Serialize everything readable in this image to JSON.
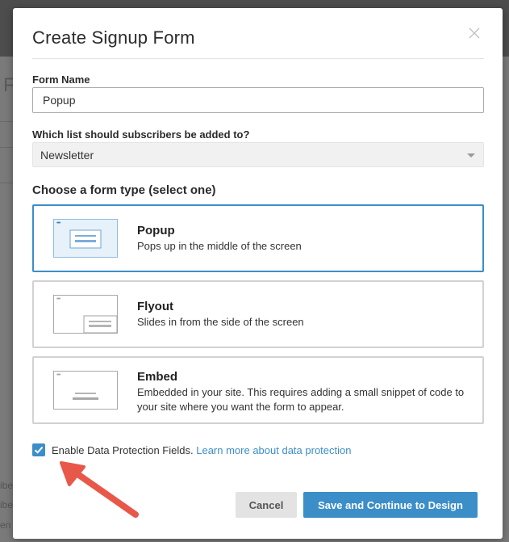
{
  "background": {
    "edge_letter": "F",
    "edge_fragments": [
      "ibe",
      "ibe",
      "en"
    ]
  },
  "modal": {
    "title": "Create Signup Form",
    "close_icon": "close-icon"
  },
  "form_name": {
    "label": "Form Name",
    "value": "Popup"
  },
  "list_select": {
    "label": "Which list should subscribers be added to?",
    "selected": "Newsletter"
  },
  "form_type": {
    "heading": "Choose a form type (select one)",
    "selected": "Popup",
    "options": [
      {
        "name": "Popup",
        "description": "Pops up in the middle of the screen",
        "icon": "popup-preview-icon"
      },
      {
        "name": "Flyout",
        "description": "Slides in from the side of the screen",
        "icon": "flyout-preview-icon"
      },
      {
        "name": "Embed",
        "description": "Embedded in your site. This requires adding a small snippet of code to your site where you want the form to appear.",
        "icon": "embed-preview-icon"
      }
    ]
  },
  "data_protection": {
    "checked": true,
    "label": "Enable Data Protection Fields.",
    "link_text": "Learn more about data protection"
  },
  "actions": {
    "cancel_label": "Cancel",
    "save_label": "Save and Continue to Design"
  },
  "colors": {
    "accent": "#3c8ec8",
    "annotation_arrow": "#e8584a"
  }
}
